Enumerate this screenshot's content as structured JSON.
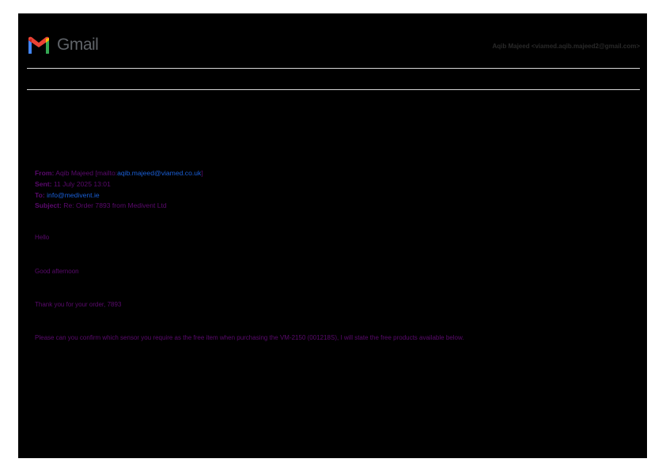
{
  "app": {
    "logo_text": "Gmail",
    "account": "Aqib Majeed <viamed.aqib.majeed2@gmail.com>"
  },
  "colors": {
    "background": "#000000",
    "quoted_text": "#5b0a6e",
    "link": "#1a5fd6",
    "divider": "#d8d8d8"
  },
  "email": {
    "from_label": "From:",
    "from_name": "Aqib Majeed [mailto:",
    "from_email": "aqib.majeed@viamed.co.uk",
    "from_close": "]",
    "sent_label": "Sent:",
    "sent_value": "11 July 2025 13:01",
    "to_label": "To:",
    "to_email": "info@medivent.ie",
    "subject_label": "Subject:",
    "subject_value": "Re: Order 7893 from Medivent Ltd",
    "body": {
      "greeting": "Hello",
      "salutation": "Good afternoon",
      "thanks": "Thank you for your order, 7893",
      "request": "Please can you confirm which sensor you require as the free item when purchasing the VM-2150 (001218S), I will state the free products available below."
    }
  }
}
